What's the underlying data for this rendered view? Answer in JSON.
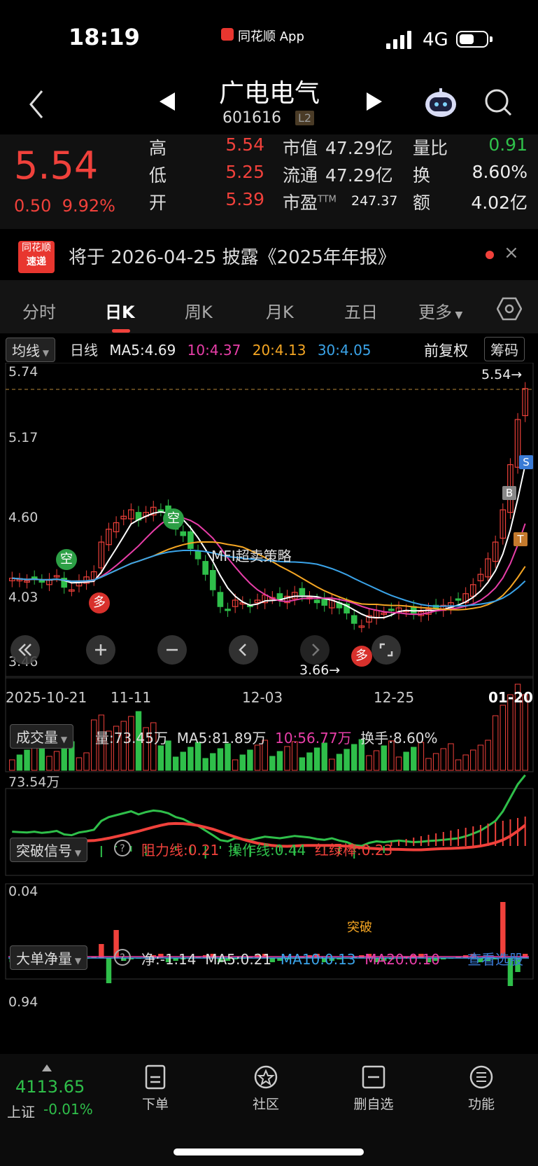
{
  "status": {
    "time": "18:19",
    "app": "同花顺 App",
    "network": "4G"
  },
  "header": {
    "name": "广电电气",
    "code": "601616",
    "badge": "L2"
  },
  "quote": {
    "price": "5.54",
    "change": "0.50",
    "change_pct": "9.92%",
    "high_label": "高",
    "high": "5.54",
    "low_label": "低",
    "low": "5.25",
    "open_label": "开",
    "open": "5.39",
    "mcap_label": "市值",
    "mcap": "47.29亿",
    "float_label": "流通",
    "float": "47.29亿",
    "pe_label": "市盈",
    "pe_sup": "TTM",
    "pe": "247.37",
    "vr_label": "量比",
    "vr": "0.91",
    "turn_label": "换",
    "turn": "8.60%",
    "amt_label": "额",
    "amt": "4.02亿"
  },
  "notice": {
    "logo_top": "同花顺",
    "logo_bottom": "速递",
    "text": "将于 2026-04-25 披露《2025年年报》",
    "close": "×"
  },
  "tabs": [
    "分时",
    "日K",
    "周K",
    "月K",
    "五日",
    "更多"
  ],
  "ma_bar": {
    "indicator": "均线",
    "period": "日线",
    "ma5": "MA5:4.69",
    "ma10": "10:4.37",
    "ma20": "20:4.13",
    "ma30": "30:4.05",
    "adjust": "前复权",
    "chip": "筹码"
  },
  "kline": {
    "y_labels": [
      "5.74",
      "5.17",
      "4.60",
      "4.03",
      "3.46"
    ],
    "high_marker": "5.54→",
    "low_marker": "3.66→",
    "strategy": "MFI超卖策略",
    "dates": [
      "2025-10-21",
      "11-11",
      "12-03",
      "12-25",
      "01-20"
    ],
    "signals": {
      "kong": "空",
      "duo": "多",
      "b": "B",
      "s": "S",
      "t": "T"
    },
    "colors": {
      "up": "#f0413b",
      "down": "#2fbf4a",
      "ma5": "#ffffff",
      "ma10": "#e83ea8",
      "ma20": "#f5a623",
      "ma30": "#3aa3e8"
    }
  },
  "volume": {
    "name": "成交量",
    "vol": "量:73.45万",
    "ma5": "MA5:81.89万",
    "ma10": "10:56.77万",
    "turnover": "换手:8.60%",
    "axis": "73.54万"
  },
  "breakout": {
    "name": "突破信号",
    "resist": "阻力线:0.21",
    "operate": "操作线:0.44",
    "bar": "红绿棒:0.23",
    "axis": "0.04",
    "label": "突破"
  },
  "bigorder": {
    "name": "大单净量",
    "net": "净:-1.14",
    "ma5": "MA5:0.21",
    "ma10": "MA10:0.13",
    "ma20": "MA20:0.10",
    "link": "查看选股",
    "axis": "0.94"
  },
  "bottom": {
    "index_value": "4113.65",
    "index_name": "上证",
    "index_change": "-0.01%",
    "nav": [
      "下单",
      "社区",
      "删自选",
      "功能"
    ]
  }
}
